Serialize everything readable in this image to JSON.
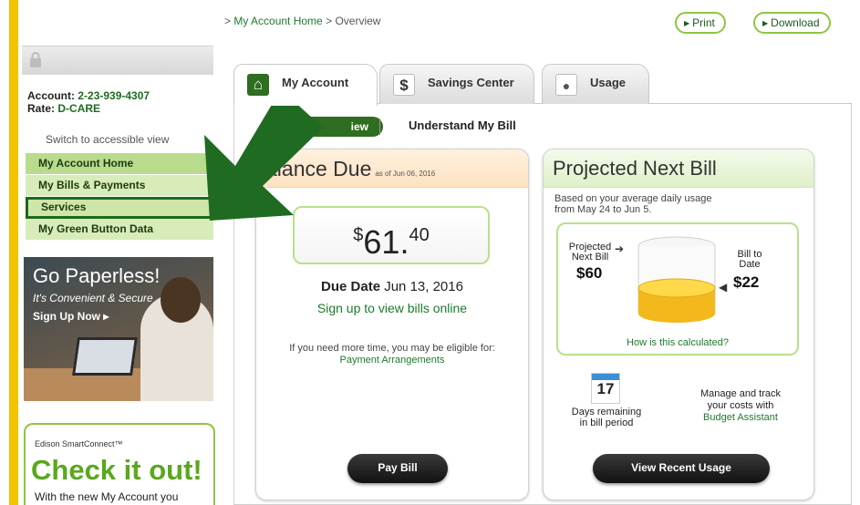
{
  "breadcrumb": {
    "prefix": ">",
    "home": "My Account Home",
    "sep": ">",
    "current": "Overview"
  },
  "top_buttons": {
    "print": "Print",
    "download": "Download"
  },
  "sidebar": {
    "account_label": "Account:",
    "account_number": "2-23-939-4307",
    "rate_label": "Rate:",
    "rate_value": "D-CARE",
    "switch_view": "Switch to accessible view",
    "nav": [
      {
        "label": "My Account Home"
      },
      {
        "label": "My Bills & Payments"
      },
      {
        "label": "Services"
      },
      {
        "label": "My Green Button Data"
      }
    ],
    "promo": {
      "title": "Go Paperless!",
      "subtitle": "It's Convenient & Secure",
      "cta": "Sign Up Now"
    },
    "smart_connect": {
      "brand": "Edison SmartConnect™",
      "headline": "Check it out!",
      "body": "With the new My Account you"
    }
  },
  "tabs": [
    {
      "label": "My Account",
      "icon": "home-icon"
    },
    {
      "label": "Savings Center",
      "icon": "dollar-icon"
    },
    {
      "label": "Usage",
      "icon": "lightbulb-icon"
    }
  ],
  "subnav": {
    "overview": "iew",
    "understand": "Understand My Bill"
  },
  "balance": {
    "title": "alance Due",
    "as_of": "as of Jun 06, 2016",
    "currency": "$",
    "dollars": "61",
    "cents": "40",
    "due_label": "Due Date",
    "due_date": "Jun 13, 2016",
    "signup": "Sign up to view bills online",
    "more_time": "If you need more time, you may be eligible for:",
    "arrangements": "Payment Arrangements",
    "pay_button": "Pay Bill"
  },
  "projected": {
    "title": "Projected Next Bill",
    "based_line1": "Based on your average daily usage",
    "based_line2": "from May 24 to Jun 5.",
    "projected_label_1": "Projected",
    "projected_label_2": "Next Bill",
    "projected_amount": "$60",
    "to_date_label_1": "Bill to",
    "to_date_label_2": "Date",
    "to_date_amount": "$22",
    "calc_link": "How is this calculated?",
    "days_number": "17",
    "days_line1": "Days remaining",
    "days_line2": "in bill period",
    "manage_line1": "Manage and track",
    "manage_line2": "your costs with",
    "manage_link": "Budget Assistant",
    "usage_button": "View Recent Usage"
  },
  "colors": {
    "accent_green": "#1d7a2c",
    "yellow_bar": "#f2c400",
    "arrow_green": "#1f6b22"
  }
}
